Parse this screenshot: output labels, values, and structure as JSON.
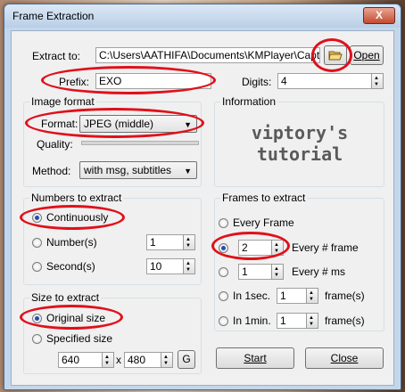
{
  "window": {
    "title": "Frame Extraction",
    "close": "X"
  },
  "extract": {
    "label": "Extract to:",
    "path": "C:\\Users\\AATHIFA\\Documents\\KMPlayer\\Capture",
    "open": "Open"
  },
  "prefix": {
    "label": "Prefix:",
    "value": "EXO"
  },
  "digits": {
    "label": "Digits:",
    "value": "4"
  },
  "image_format": {
    "title": "Image format",
    "format_label": "Format:",
    "format_value": "JPEG (middle)",
    "quality_label": "Quality:",
    "method_label": "Method:",
    "method_value": "with msg, subtitles"
  },
  "information": {
    "title": "Information",
    "watermark_line1": "viptory's",
    "watermark_line2": "tutorial"
  },
  "numbers": {
    "title": "Numbers to extract",
    "continuously": "Continuously",
    "numbers": "Number(s)",
    "numbers_value": "1",
    "seconds": "Second(s)",
    "seconds_value": "10"
  },
  "size": {
    "title": "Size to extract",
    "original": "Original size",
    "specified": "Specified size",
    "width": "640",
    "x": "x",
    "height": "480",
    "g": "G"
  },
  "frames": {
    "title": "Frames to extract",
    "every_frame": "Every Frame",
    "n_frame_value": "2",
    "n_frame_label": "Every # frame",
    "n_ms_value": "1",
    "n_ms_label": "Every # ms",
    "in1sec_label": "In 1sec.",
    "in1sec_value": "1",
    "in1sec_unit": "frame(s)",
    "in1min_label": "In 1min.",
    "in1min_value": "1",
    "in1min_unit": "frame(s)"
  },
  "buttons": {
    "start": "Start",
    "close": "Close"
  },
  "colors": {
    "annotation": "#e0101a",
    "window_frame": "#c4d7ea",
    "client": "#f0f0f0"
  }
}
